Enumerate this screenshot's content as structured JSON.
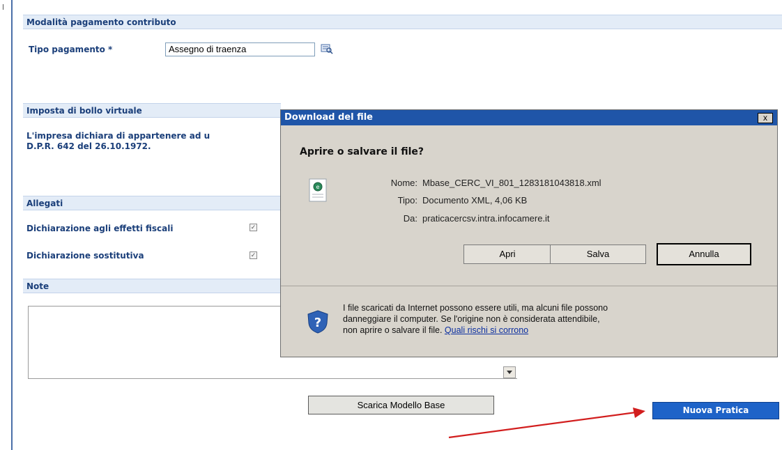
{
  "sections": {
    "pagamento": {
      "title": "Modalità pagamento contributo",
      "tipo_label": "Tipo pagamento *",
      "tipo_value": "Assegno di traenza"
    },
    "bollo": {
      "title": "Imposta di bollo virtuale",
      "text_line1": "L'impresa dichiara di appartenere ad u",
      "text_line2": "D.P.R. 642 del 26.10.1972."
    },
    "allegati": {
      "title": "Allegati",
      "items": [
        {
          "label": "Dichiarazione agli effetti fiscali",
          "checked": true
        },
        {
          "label": "Dichiarazione sostitutiva",
          "checked": true
        }
      ]
    },
    "note": {
      "title": "Note"
    }
  },
  "buttons": {
    "scarica": "Scarica Modello Base",
    "nuova": "Nuova Pratica"
  },
  "dialog": {
    "title": "Download del file",
    "close": "x",
    "question": "Aprire o salvare il file?",
    "fields": [
      {
        "key": "Nome:",
        "value": "Mbase_CERC_VI_801_1283181043818.xml"
      },
      {
        "key": "Tipo:",
        "value": "Documento XML, 4,06 KB"
      },
      {
        "key": "Da:",
        "value": "praticacercsv.intra.infocamere.it"
      }
    ],
    "buttons": {
      "apri": "Apri",
      "salva": "Salva",
      "annulla": "Annulla"
    },
    "warning": {
      "line1": "I file scaricati da Internet possono essere utili, ma alcuni file possono",
      "line2": "danneggiare il computer. Se l'origine non è considerata attendibile,",
      "line3_prefix": "non aprire o salvare il file.",
      "link": "Quali rischi si corrono"
    }
  },
  "colors": {
    "section_header_bg": "#e3ecf7",
    "label_blue": "#1b3f7a",
    "dialog_title_bg": "#1f55a8",
    "primary_button": "#1e63c8",
    "arrow": "#d21e1e"
  }
}
